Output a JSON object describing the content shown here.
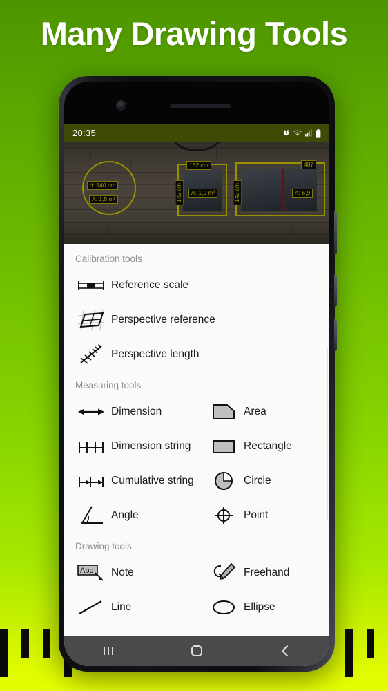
{
  "headline": "Many Drawing Tools",
  "background": {
    "top_color": "#4d9400",
    "bottom_color": "#e6ff00",
    "accent": "#6fbc00"
  },
  "phone": {
    "camera_icon": "front-camera",
    "earpiece_icon": "earpiece-speaker"
  },
  "statusbar": {
    "time": "20:35",
    "background": "#3f4a07",
    "icons": [
      "alarm-icon",
      "wifi-icon",
      "signal-icon",
      "battery-icon"
    ]
  },
  "photo": {
    "annotations": [
      {
        "text": "d: 140 cm",
        "kind": "diameter"
      },
      {
        "text": "A: 1,5 m²",
        "kind": "area"
      },
      {
        "text": "132 cm",
        "kind": "width"
      },
      {
        "text": "142 cm",
        "kind": "height"
      },
      {
        "text": "A: 1,9 m²",
        "kind": "area"
      },
      {
        "text": "142 cm",
        "kind": "height"
      },
      {
        "text": "487",
        "kind": "width"
      },
      {
        "text": "A: 6,9",
        "kind": "area"
      }
    ],
    "annotation_color": "#dcd000"
  },
  "panel": {
    "sections": [
      {
        "title": "Calibration tools",
        "layout": "single",
        "items": [
          {
            "label": "Reference scale",
            "icon": "reference-scale-icon"
          },
          {
            "label": "Perspective reference",
            "icon": "perspective-reference-icon"
          },
          {
            "label": "Perspective length",
            "icon": "perspective-length-icon"
          }
        ]
      },
      {
        "title": "Measuring tools",
        "layout": "two-column",
        "left": [
          {
            "label": "Dimension",
            "icon": "dimension-icon"
          },
          {
            "label": "Dimension string",
            "icon": "dimension-string-icon"
          },
          {
            "label": "Cumulative string",
            "icon": "cumulative-string-icon"
          },
          {
            "label": "Angle",
            "icon": "angle-icon"
          }
        ],
        "right": [
          {
            "label": "Area",
            "icon": "area-icon"
          },
          {
            "label": "Rectangle",
            "icon": "rectangle-icon"
          },
          {
            "label": "Circle",
            "icon": "circle-icon"
          },
          {
            "label": "Point",
            "icon": "point-icon"
          }
        ]
      },
      {
        "title": "Drawing tools",
        "layout": "two-column",
        "left": [
          {
            "label": "Note",
            "icon": "note-icon"
          },
          {
            "label": "Line",
            "icon": "line-icon"
          }
        ],
        "right": [
          {
            "label": "Freehand",
            "icon": "freehand-icon"
          },
          {
            "label": "Ellipse",
            "icon": "ellipse-icon"
          }
        ]
      }
    ]
  },
  "navbar": {
    "buttons": [
      {
        "name": "recents",
        "icon": "recents-icon"
      },
      {
        "name": "home",
        "icon": "home-icon"
      },
      {
        "name": "back",
        "icon": "back-icon"
      }
    ]
  }
}
